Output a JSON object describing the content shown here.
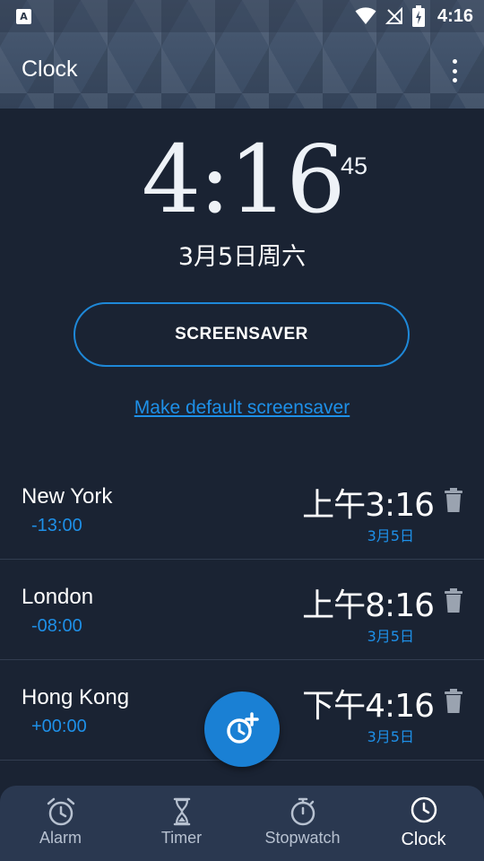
{
  "status_bar": {
    "left_icon": "A",
    "time": "4:16",
    "icons": [
      "wifi-icon",
      "no-signal-icon",
      "battery-charging-icon"
    ]
  },
  "header": {
    "title": "Clock",
    "menu_icon": "more-vert-icon"
  },
  "clock": {
    "time": "4:16",
    "seconds": "45",
    "date": "3月5日周六"
  },
  "screensaver_button": "SCREENSAVER",
  "default_screensaver_link": "Make default screensaver",
  "cities": [
    {
      "name": "New York",
      "offset": "-13:00",
      "time": "上午3:16",
      "date": "3月5日"
    },
    {
      "name": "London",
      "offset": "-08:00",
      "time": "上午8:16",
      "date": "3月5日"
    },
    {
      "name": "Hong Kong",
      "offset": "+00:00",
      "time": "下午4:16",
      "date": "3月5日"
    }
  ],
  "fab_icon": "add-clock-icon",
  "nav": [
    {
      "label": "Alarm",
      "icon": "alarm-icon"
    },
    {
      "label": "Timer",
      "icon": "hourglass-icon"
    },
    {
      "label": "Stopwatch",
      "icon": "stopwatch-icon"
    },
    {
      "label": "Clock",
      "icon": "clock-icon",
      "active": true
    }
  ],
  "colors": {
    "background": "#1a2333",
    "accent": "#1e90e8",
    "fab": "#1a80d4",
    "nav_background": "#2a3850"
  }
}
